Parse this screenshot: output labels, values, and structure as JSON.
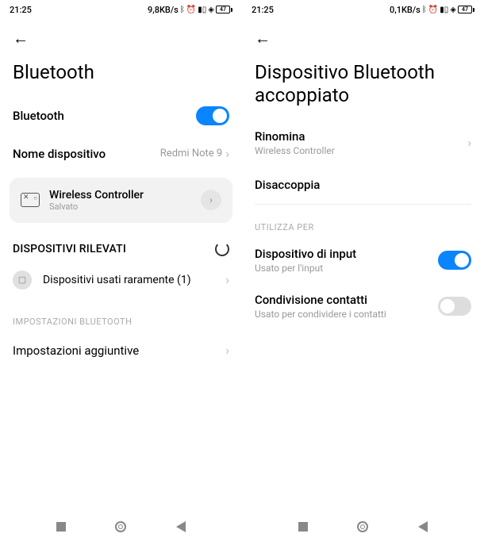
{
  "left": {
    "status": {
      "time": "21:25",
      "net": "9,8KB/s",
      "battery": "47"
    },
    "title": "Bluetooth",
    "bluetooth_row": {
      "label": "Bluetooth",
      "on": true
    },
    "device_name_row": {
      "label": "Nome dispositivo",
      "value": "Redmi Note 9"
    },
    "paired_device": {
      "name": "Wireless Controller",
      "status": "Salvato"
    },
    "detected_header": "DISPOSITIVI RILEVATI",
    "rarely_used": "Dispositivi usati raramente (1)",
    "bt_settings_caption": "IMPOSTAZIONI BLUETOOTH",
    "additional": "Impostazioni aggiuntive"
  },
  "right": {
    "status": {
      "time": "21:25",
      "net": "0,1KB/s",
      "battery": "47"
    },
    "title": "Dispositivo Bluetooth accoppiato",
    "rename": {
      "label": "Rinomina",
      "value": "Wireless Controller"
    },
    "unpair": "Disaccoppia",
    "use_for_caption": "UTILIZZA PER",
    "input_device": {
      "label": "Dispositivo di input",
      "sub": "Usato per l'input",
      "on": true
    },
    "contact_sharing": {
      "label": "Condivisione contatti",
      "sub": "Usato per condividere i contatti",
      "on": false
    }
  }
}
